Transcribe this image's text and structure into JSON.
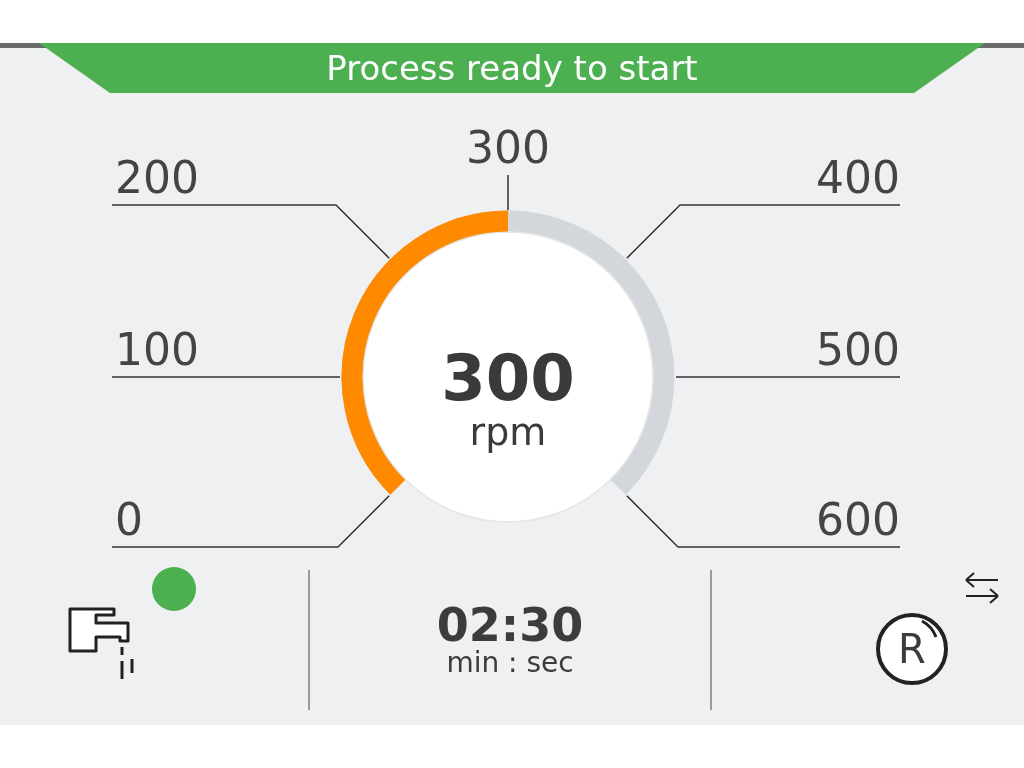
{
  "status_banner": {
    "text": "Process ready to start"
  },
  "gauge": {
    "top_label": "300",
    "left_labels": [
      "200",
      "100",
      "0"
    ],
    "right_labels": [
      "400",
      "500",
      "600"
    ],
    "value": "300",
    "unit": "rpm"
  },
  "water": {
    "active": true
  },
  "timer": {
    "value": "02:30",
    "unit": "min : sec"
  },
  "mode": {
    "letter": "R"
  }
}
